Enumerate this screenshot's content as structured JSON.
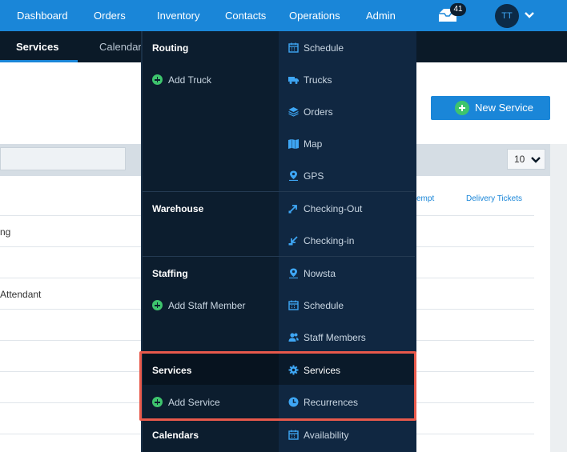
{
  "topnav": {
    "items": [
      "Dashboard",
      "Orders",
      "Inventory",
      "Contacts",
      "Operations",
      "Admin"
    ],
    "active": "Operations",
    "mail_count": "41",
    "avatar_initials": "TT"
  },
  "subnav": {
    "tabs": [
      "Services",
      "Calendars"
    ],
    "active": "Services"
  },
  "header": {
    "new_service_label": "New Service"
  },
  "table": {
    "per_page": "10",
    "column_headers": [
      "empt",
      "Delivery Tickets"
    ],
    "rows": [
      "ng",
      "",
      "Attendant",
      "",
      "",
      "",
      "",
      ""
    ]
  },
  "dropdown": {
    "sections": [
      {
        "title": "Routing",
        "add_label": "Add Truck",
        "links": [
          {
            "label": "Schedule",
            "icon": "calendar-icon"
          },
          {
            "label": "Trucks",
            "icon": "truck-icon"
          },
          {
            "label": "Orders",
            "icon": "layers-icon"
          },
          {
            "label": "Map",
            "icon": "map-icon"
          },
          {
            "label": "GPS",
            "icon": "location-pin-icon"
          }
        ]
      },
      {
        "title": "Warehouse",
        "add_label": "",
        "links": [
          {
            "label": "Checking-Out",
            "icon": "arrow-out-icon"
          },
          {
            "label": "Checking-in",
            "icon": "arrow-in-icon"
          }
        ]
      },
      {
        "title": "Staffing",
        "add_label": "Add Staff Member",
        "links": [
          {
            "label": "Nowsta",
            "icon": "location-pin-icon"
          },
          {
            "label": "Schedule",
            "icon": "calendar-icon"
          },
          {
            "label": "Staff Members",
            "icon": "users-icon"
          }
        ]
      },
      {
        "title": "Services",
        "add_label": "Add Service",
        "links": [
          {
            "label": "Services",
            "icon": "gear-icon"
          },
          {
            "label": "Recurrences",
            "icon": "clock-icon"
          }
        ]
      },
      {
        "title": "Calendars",
        "add_label": "",
        "links": [
          {
            "label": "Availability",
            "icon": "calendar-icon"
          }
        ]
      }
    ]
  },
  "colors": {
    "brand_blue": "#1a86d8",
    "nav_dark": "#0b1a28",
    "menu_dark": "#0c1d2e",
    "add_green": "#3ec46d",
    "highlight_red": "#e8594b"
  }
}
